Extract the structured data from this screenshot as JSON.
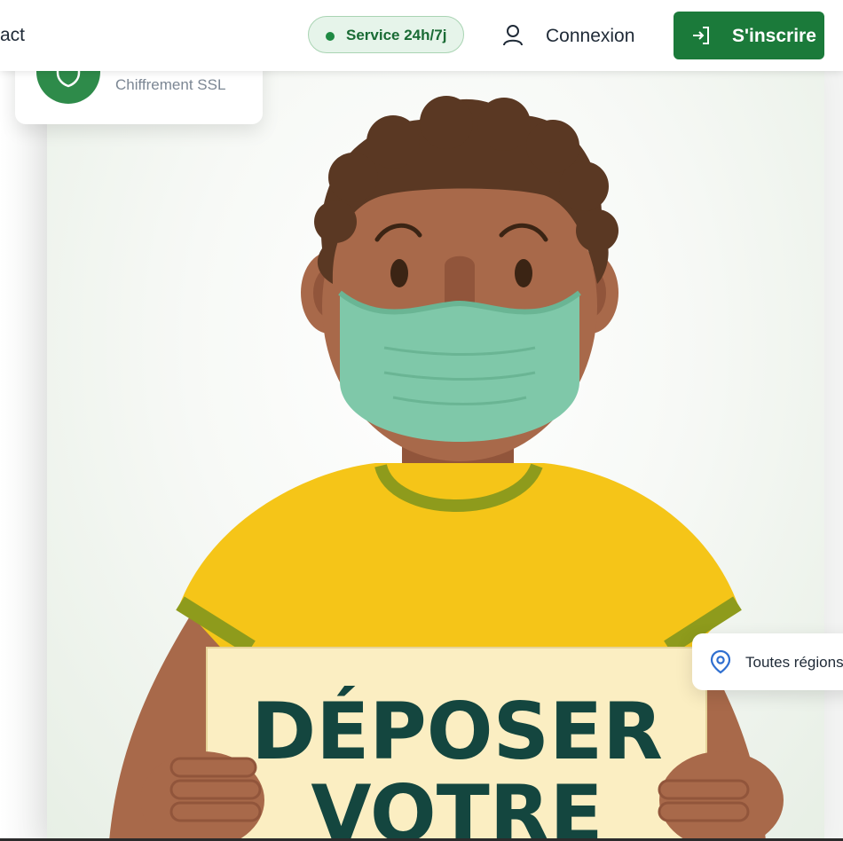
{
  "nav": {
    "contact_fragment": "act",
    "status": "Service 24h/7j",
    "login": "Connexion",
    "signup": "S'inscrire"
  },
  "ssl_card": {
    "label": "Chiffrement SSL"
  },
  "region_card": {
    "label": "Toutes régions"
  },
  "illustration": {
    "sign_line1": "DÉPOSER",
    "sign_line2": "VOTRE"
  },
  "colors": {
    "brand_green": "#1b7a3a",
    "status_green": "#1e8a43",
    "shirt_yellow": "#f5c518",
    "skin": "#a8694a",
    "mask": "#7fc8a9"
  },
  "icons": [
    "shield-icon",
    "user-icon",
    "login-arrow-icon",
    "map-pin-icon"
  ]
}
